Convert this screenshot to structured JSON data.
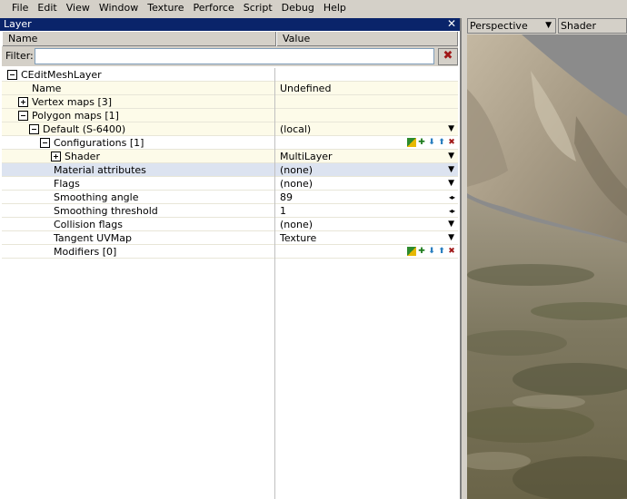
{
  "menubar": {
    "items": [
      "File",
      "Edit",
      "View",
      "Window",
      "Texture",
      "Perforce",
      "Script",
      "Debug",
      "Help"
    ]
  },
  "panel": {
    "title": "Layer",
    "close_glyph": "✕",
    "columns": {
      "name": "Name",
      "value": "Value"
    },
    "filter": {
      "label": "Filter:",
      "value": "",
      "clear_glyph": "✖"
    }
  },
  "tree": {
    "root": "CEditMeshLayer",
    "name_label": "Name",
    "name_value": "Undefined",
    "vertex_maps": "Vertex maps [3]",
    "polygon_maps": "Polygon maps [1]",
    "default_map": "Default (S-6400)",
    "default_value": "(local)",
    "configurations": "Configurations [1]",
    "shader_label": "Shader",
    "shader_value": "MultiLayer",
    "material_label": "Material attributes",
    "material_value": "(none)",
    "flags_label": "Flags",
    "flags_value": "(none)",
    "smooth_angle_label": "Smoothing angle",
    "smooth_angle_value": "89",
    "smooth_threshold_label": "Smoothing threshold",
    "smooth_threshold_value": "1",
    "collision_label": "Collision flags",
    "collision_value": "(none)",
    "tangent_label": "Tangent UVMap",
    "tangent_value": "Texture",
    "modifiers": "Modifiers [0]"
  },
  "icons": {
    "dropdown": "▼",
    "spinner": "◂▸",
    "add": "✚",
    "down": "⬇",
    "up": "⬆",
    "delete": "✖"
  },
  "viewport": {
    "camera": "Perspective",
    "mode": "Shader",
    "camera_arrow": "▼"
  }
}
